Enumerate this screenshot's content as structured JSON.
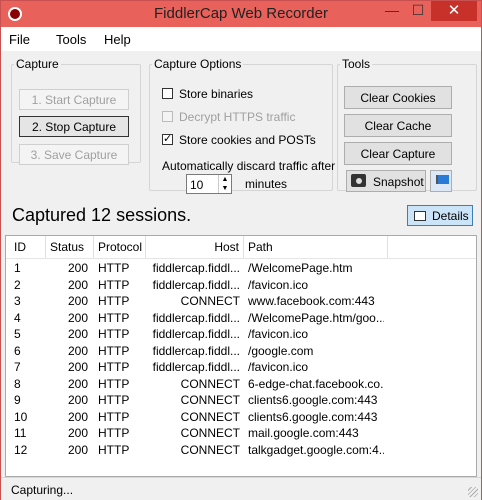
{
  "window": {
    "title": "FiddlerCap Web Recorder",
    "min_glyph": "—",
    "max_glyph": "☐",
    "close_glyph": "✕"
  },
  "menu": [
    "File",
    "Tools",
    "Help"
  ],
  "capture": {
    "legend": "Capture",
    "start": "1. Start Capture",
    "stop": "2. Stop Capture",
    "save": "3. Save Capture"
  },
  "options": {
    "legend": "Capture Options",
    "store_binaries": "Store binaries",
    "decrypt_https": "Decrypt HTTPS traffic",
    "store_cookies": "Store cookies and POSTs",
    "check_mark": "✓",
    "discard_label": "Automatically discard traffic after",
    "discard_value": "10",
    "spin_up": "▲",
    "spin_down": "▼",
    "minutes_label": "minutes"
  },
  "tools": {
    "legend": "Tools",
    "clear_cookies": "Clear Cookies",
    "clear_cache": "Clear Cache",
    "clear_capture": "Clear Capture",
    "snapshot": "Snapshot"
  },
  "summary": "Captured 12 sessions.",
  "details_label": "Details",
  "columns": [
    "ID",
    "Status",
    "Protocol",
    "Host",
    "Path"
  ],
  "sessions": [
    {
      "id": "1",
      "status": "200",
      "protocol": "HTTP",
      "host": "fiddlercap.fiddl...",
      "path": "/WelcomePage.htm"
    },
    {
      "id": "2",
      "status": "200",
      "protocol": "HTTP",
      "host": "fiddlercap.fiddl...",
      "path": "/favicon.ico"
    },
    {
      "id": "3",
      "status": "200",
      "protocol": "HTTP",
      "host": "CONNECT",
      "path": "www.facebook.com:443"
    },
    {
      "id": "4",
      "status": "200",
      "protocol": "HTTP",
      "host": "fiddlercap.fiddl...",
      "path": "/WelcomePage.htm/goo..."
    },
    {
      "id": "5",
      "status": "200",
      "protocol": "HTTP",
      "host": "fiddlercap.fiddl...",
      "path": "/favicon.ico"
    },
    {
      "id": "6",
      "status": "200",
      "protocol": "HTTP",
      "host": "fiddlercap.fiddl...",
      "path": "/google.com"
    },
    {
      "id": "7",
      "status": "200",
      "protocol": "HTTP",
      "host": "fiddlercap.fiddl...",
      "path": "/favicon.ico"
    },
    {
      "id": "8",
      "status": "200",
      "protocol": "HTTP",
      "host": "CONNECT",
      "path": "6-edge-chat.facebook.co..."
    },
    {
      "id": "9",
      "status": "200",
      "protocol": "HTTP",
      "host": "CONNECT",
      "path": "clients6.google.com:443"
    },
    {
      "id": "10",
      "status": "200",
      "protocol": "HTTP",
      "host": "CONNECT",
      "path": "clients6.google.com:443"
    },
    {
      "id": "11",
      "status": "200",
      "protocol": "HTTP",
      "host": "CONNECT",
      "path": "mail.google.com:443"
    },
    {
      "id": "12",
      "status": "200",
      "protocol": "HTTP",
      "host": "CONNECT",
      "path": "talkgadget.google.com:4..."
    }
  ],
  "status_text": "Capturing..."
}
